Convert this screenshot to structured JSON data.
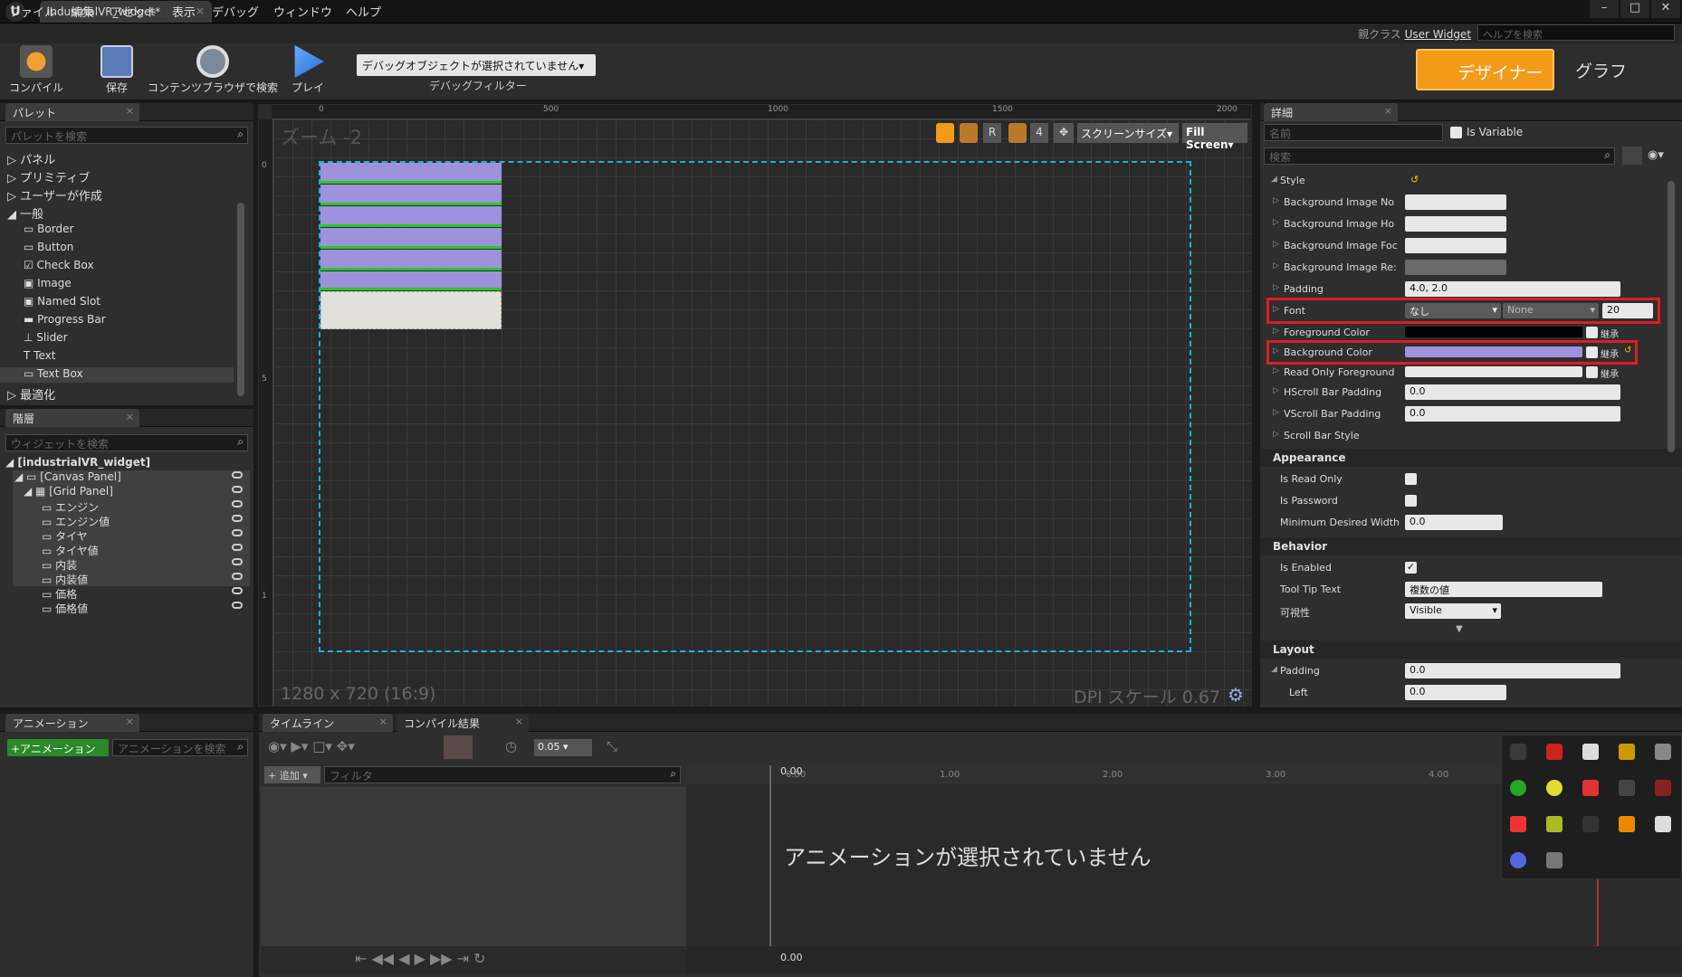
{
  "window": {
    "tab_title": "industrialVR_widget*",
    "close": "×"
  },
  "menu": [
    "ファイル",
    "編集",
    "アセット",
    "表示",
    "デバッグ",
    "ウィンドウ",
    "ヘルプ"
  ],
  "parent_class": {
    "label": "親クラス",
    "value": "User Widget"
  },
  "help_search": {
    "placeholder": "ヘルプを検索"
  },
  "toolbar": {
    "compile": "コンパイル",
    "save": "保存",
    "browse": "コンテンツブラウザで検索",
    "play": "プレイ",
    "debug_dropdown": "デバッグオブジェクトが選択されていません▾",
    "debug_label": "デバッグフィルター",
    "designer": "デザイナー",
    "graph": "グラフ"
  },
  "palette": {
    "tab": "パレット",
    "search": "パレットを検索",
    "categories": [
      "パネル",
      "プリミティブ",
      "ユーザーが作成",
      "一般"
    ],
    "widgets": [
      "Border",
      "Button",
      "Check Box",
      "Image",
      "Named Slot",
      "Progress Bar",
      "Slider",
      "Text",
      "Text Box"
    ],
    "optimize": "最適化"
  },
  "hierarchy": {
    "tab": "階層",
    "search": "ウィジェットを検索",
    "root": "[industrialVR_widget]",
    "canvas": "[Canvas Panel]",
    "grid": "[Grid Panel]",
    "children": [
      "エンジン",
      "エンジン値",
      "タイヤ",
      "タイヤ値",
      "内装",
      "内装値",
      "価格",
      "価格値"
    ]
  },
  "viewport": {
    "zoom": "ズーム -2",
    "resolution": "1280 x 720 (16:9)",
    "dpi": "DPI スケール 0.67",
    "ruler_h": [
      "0",
      "500",
      "1000",
      "1500",
      "2000"
    ],
    "ruler_v": [
      "0",
      "5",
      "1"
    ],
    "toolbar": {
      "r": "R",
      "four": "4",
      "screen_size": "スクリーンサイズ▾",
      "fill": "Fill Screen▾"
    }
  },
  "details": {
    "tab": "詳細",
    "name_placeholder": "名前",
    "is_variable": "Is Variable",
    "search": "検索",
    "style_label": "Style",
    "style_rows": [
      "Background Image No",
      "Background Image Ho",
      "Background Image Foc",
      "Background Image Re:",
      "Padding"
    ],
    "padding_value": "4.0, 2.0",
    "font": {
      "label": "Font",
      "family": "なし",
      "typeface": "None",
      "size": "20"
    },
    "foreground": {
      "label": "Foreground Color",
      "inherit": "継承"
    },
    "background": {
      "label": "Background Color",
      "inherit": "継承"
    },
    "readonly_fg": {
      "label": "Read Only Foreground",
      "inherit": "継承"
    },
    "hscroll": {
      "label": "HScroll Bar Padding",
      "value": "0.0"
    },
    "vscroll": {
      "label": "VScroll Bar Padding",
      "value": "0.0"
    },
    "scrollbar_style": "Scroll Bar Style",
    "appearance": "Appearance",
    "is_readonly": "Is Read Only",
    "is_password": "Is Password",
    "min_width": {
      "label": "Minimum Desired Width",
      "value": "0.0"
    },
    "behavior": "Behavior",
    "is_enabled": "Is Enabled",
    "tooltip": {
      "label": "Tool Tip Text",
      "value": "複数の値"
    },
    "visibility": {
      "label": "可視性",
      "value": "Visible"
    },
    "layout": "Layout",
    "layout_padding": {
      "label": "Padding",
      "value": "0.0"
    },
    "left": {
      "label": "Left",
      "value": "0.0"
    },
    "colors": {
      "background_color": "#9e92dc",
      "foreground_color": "#000000",
      "highlight": "#e01b24"
    }
  },
  "animation": {
    "tab": "アニメーション",
    "add": "+アニメーション",
    "search": "アニメーションを検索"
  },
  "timeline": {
    "tab1": "タイムライン",
    "tab2": "コンパイル結果",
    "add": "+ 追加 ▾",
    "filter": "フィルタ",
    "snap": "0.05",
    "message": "アニメーションが選択されていません",
    "time_start": "0.00",
    "ticks": [
      "0.00",
      "1.00",
      "2.00",
      "3.00",
      "4.00"
    ]
  }
}
